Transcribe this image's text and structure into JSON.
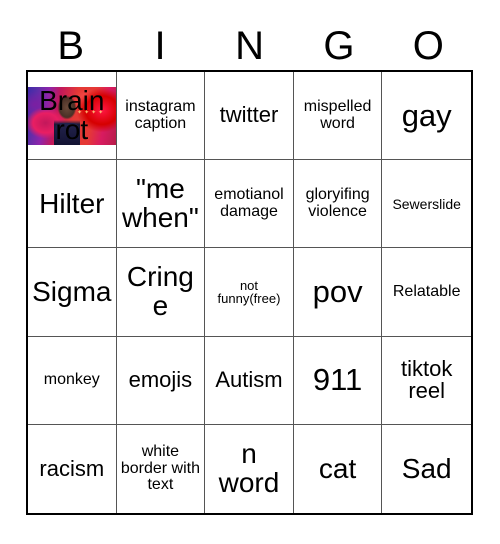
{
  "card": {
    "title": "BINGO",
    "header_letters": [
      "B",
      "I",
      "N",
      "G",
      "O"
    ],
    "grid_border_color": "#000000",
    "cell_border_color": "#555555",
    "background_color": "#ffffff",
    "text_color": "#000000",
    "rows": [
      [
        {
          "text": "Brain rot",
          "size": "fs-lg",
          "has_image": true,
          "image_name": "brainrot-meme-image"
        },
        {
          "text": "instagram caption",
          "size": "fs-sm",
          "has_image": false
        },
        {
          "text": "twitter",
          "size": "fs-md",
          "has_image": false
        },
        {
          "text": "mispelled word",
          "size": "fs-sm",
          "has_image": false
        },
        {
          "text": "gay",
          "size": "fs-xl",
          "has_image": false
        }
      ],
      [
        {
          "text": "Hilter",
          "size": "fs-lg",
          "has_image": false
        },
        {
          "text": "\"me when\"",
          "size": "fs-lg",
          "has_image": false
        },
        {
          "text": "emotianol damage",
          "size": "fs-sm",
          "has_image": false
        },
        {
          "text": "gloryifing violence",
          "size": "fs-sm",
          "has_image": false
        },
        {
          "text": "Sewerslide",
          "size": "fs-xs",
          "has_image": false
        }
      ],
      [
        {
          "text": "Sigma",
          "size": "fs-lg",
          "has_image": false
        },
        {
          "text": "Cringe",
          "size": "fs-lg",
          "has_image": false
        },
        {
          "text": "not funny(free)",
          "size": "fs-xxs",
          "has_image": false
        },
        {
          "text": "pov",
          "size": "fs-xl",
          "has_image": false
        },
        {
          "text": "Relatable",
          "size": "fs-sm",
          "has_image": false
        }
      ],
      [
        {
          "text": "monkey",
          "size": "fs-sm",
          "has_image": false
        },
        {
          "text": "emojis",
          "size": "fs-md",
          "has_image": false
        },
        {
          "text": "Autism",
          "size": "fs-md",
          "has_image": false
        },
        {
          "text": "911",
          "size": "fs-xl",
          "has_image": false
        },
        {
          "text": "tiktok reel",
          "size": "fs-md",
          "has_image": false
        }
      ],
      [
        {
          "text": "racism",
          "size": "fs-md",
          "has_image": false
        },
        {
          "text": "white border with text",
          "size": "fs-sm",
          "has_image": false
        },
        {
          "text": "n word",
          "size": "fs-lg",
          "has_image": false
        },
        {
          "text": "cat",
          "size": "fs-lg",
          "has_image": false
        },
        {
          "text": "Sad",
          "size": "fs-lg",
          "has_image": false
        }
      ]
    ]
  }
}
